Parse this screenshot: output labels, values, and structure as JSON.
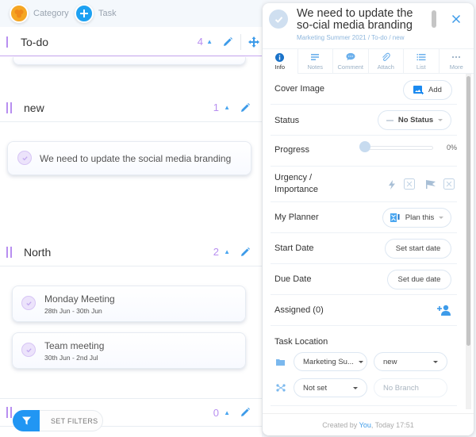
{
  "toolbar": {
    "category_label": "Category",
    "task_label": "Task",
    "category_color": "#f5a623",
    "task_color": "#1da1f2"
  },
  "sections": [
    {
      "title": "To-do",
      "count": "4"
    },
    {
      "title": "new",
      "count": "1"
    },
    {
      "title": "North",
      "count": "2"
    },
    {
      "title": "",
      "count": "0"
    }
  ],
  "cards": {
    "new": [
      {
        "title": "We need to update the social media branding"
      }
    ],
    "north": [
      {
        "title": "Monday Meeting",
        "dates": "28th Jun - 30th Jun"
      },
      {
        "title": "Team meeting",
        "dates": "30th Jun - 2nd Jul"
      }
    ]
  },
  "filters": {
    "label": "SET FILTERS"
  },
  "panel": {
    "title": "We need to update the so-cial media branding",
    "breadcrumb": "Marketing Summer 2021 / To-do / new",
    "tabs": [
      {
        "label": "Info",
        "icon": "info-icon"
      },
      {
        "label": "Notes",
        "icon": "notes-icon"
      },
      {
        "label": "Comment",
        "icon": "comment-icon"
      },
      {
        "label": "Attach",
        "icon": "paperclip-icon"
      },
      {
        "label": "List",
        "icon": "list-icon"
      },
      {
        "label": "More",
        "icon": "more-icon"
      }
    ],
    "cover_image": {
      "label": "Cover Image",
      "button": "Add"
    },
    "status": {
      "label": "Status",
      "value": "No Status"
    },
    "progress": {
      "label": "Progress",
      "value": 0,
      "display": "0%"
    },
    "urgency": {
      "label_line1": "Urgency /",
      "label_line2": "Importance"
    },
    "planner": {
      "label": "My Planner",
      "button": "Plan this"
    },
    "start_date": {
      "label": "Start Date",
      "button": "Set start date"
    },
    "due_date": {
      "label": "Due Date",
      "button": "Set due date"
    },
    "assigned": {
      "label": "Assigned (0)"
    },
    "task_location": {
      "label": "Task Location",
      "project": "Marketing Su...",
      "section": "new",
      "branch_type": "Not set",
      "branch_placeholder": "No Branch"
    },
    "footer": {
      "prefix": "Created by ",
      "user": "You",
      "suffix": ", Today 17:51"
    }
  }
}
